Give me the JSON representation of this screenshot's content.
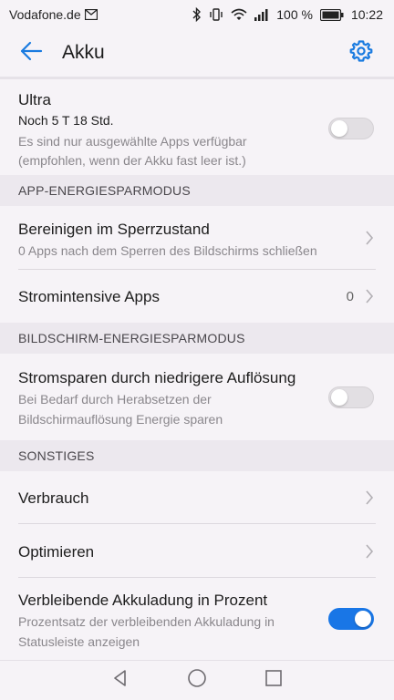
{
  "status_bar": {
    "carrier": "Vodafone.de",
    "battery_percent": "100 %",
    "time": "10:22"
  },
  "app_bar": {
    "title": "Akku"
  },
  "ultra": {
    "title": "Ultra",
    "remaining": "Noch 5 T 18 Std.",
    "description_line1": "Es sind nur ausgewählte Apps verfügbar",
    "description_line2": "(empfohlen, wenn der Akku fast leer ist.)",
    "enabled": false
  },
  "section_app": {
    "header": "APP-ENERGIESPARMODUS",
    "items": [
      {
        "title": "Bereinigen im Sperrzustand",
        "subtitle": "0 Apps nach dem Sperren des Bildschirms schließen"
      },
      {
        "title": "Stromintensive Apps",
        "value": "0"
      }
    ]
  },
  "section_screen": {
    "header": "BILDSCHIRM-ENERGIESPARMODUS",
    "item": {
      "title": "Stromsparen durch niedrigere Auflösung",
      "subtitle_line1": "Bei Bedarf durch Herabsetzen der",
      "subtitle_line2": "Bildschirmauflösung Energie sparen",
      "enabled": false
    }
  },
  "section_misc": {
    "header": "SONSTIGES",
    "items": [
      {
        "title": "Verbrauch"
      },
      {
        "title": "Optimieren"
      }
    ],
    "percent_item": {
      "title": "Verbleibende Akkuladung in Prozent",
      "subtitle_line1": "Prozentsatz der verbleibenden Akkuladung in",
      "subtitle_line2": "Statusleiste anzeigen",
      "enabled": true
    }
  },
  "colors": {
    "accent": "#1976e6",
    "background": "#f6f3f7",
    "section_header_bg": "#ece8ee"
  },
  "icons": {
    "back": "arrow-left-icon",
    "settings": "gear-icon",
    "chevron": "chevron-right-icon"
  }
}
